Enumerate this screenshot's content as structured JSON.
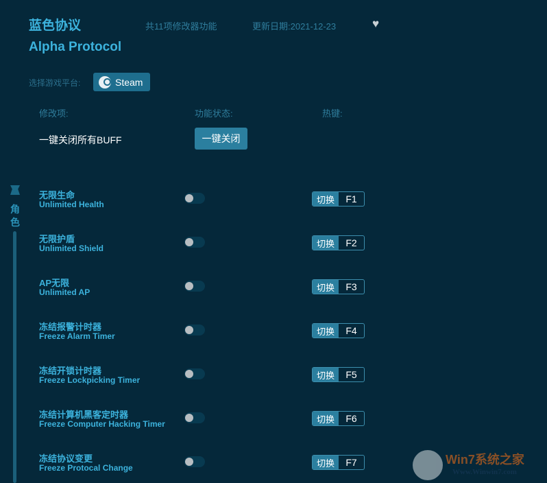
{
  "header": {
    "title_cn": "蓝色协议",
    "title_en": "Alpha Protocol",
    "feature_count": "共11项修改器功能",
    "update_date": "更新日期:2021-12-23"
  },
  "platform": {
    "label": "选择游戏平台:",
    "selected": "Steam"
  },
  "columns": {
    "item": "修改项:",
    "status": "功能状态:",
    "hotkey": "热键:"
  },
  "buff": {
    "label": "一键关闭所有BUFF",
    "button": "一键关闭"
  },
  "sidebar": {
    "category_chars": [
      "角",
      "色"
    ]
  },
  "rows": [
    {
      "cn": "无限生命",
      "en": "Unlimited Health",
      "switch": "切换",
      "key": "F1",
      "on": false
    },
    {
      "cn": "无限护盾",
      "en": "Unlimited Shield",
      "switch": "切换",
      "key": "F2",
      "on": false
    },
    {
      "cn": "AP无限",
      "en": "Unlimited AP",
      "switch": "切换",
      "key": "F3",
      "on": false
    },
    {
      "cn": "冻结报警计时器",
      "en": "Freeze Alarm Timer",
      "switch": "切换",
      "key": "F4",
      "on": false
    },
    {
      "cn": "冻结开锁计时器",
      "en": "Freeze Lockpicking Timer",
      "switch": "切换",
      "key": "F5",
      "on": false
    },
    {
      "cn": "冻结计算机黑客定时器",
      "en": "Freeze Computer Hacking Timer",
      "switch": "切换",
      "key": "F6",
      "on": false
    },
    {
      "cn": "冻结协议变更",
      "en": "Freeze Protocal Change",
      "switch": "切换",
      "key": "F7",
      "on": false
    }
  ],
  "watermark": {
    "title": "Win7系统之家",
    "url": "Www.Winwin7.com"
  }
}
